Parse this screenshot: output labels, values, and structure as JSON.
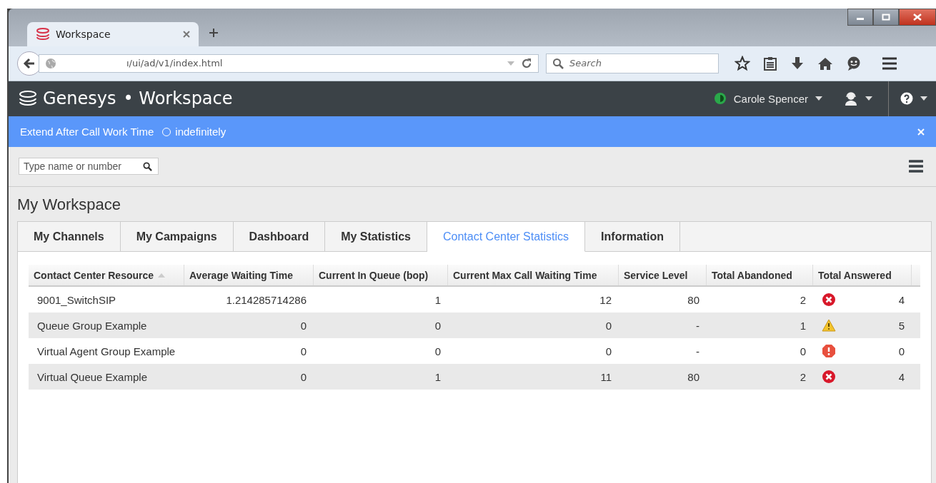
{
  "browser": {
    "tab": {
      "title": "Workspace"
    },
    "url": "ı/ui/ad/v1/index.html",
    "search": {
      "placeholder": "Search"
    }
  },
  "app": {
    "brand": "Genesys",
    "title": "• Workspace",
    "user": {
      "name": "Carole Spencer"
    }
  },
  "banner": {
    "label": "Extend After Call Work Time",
    "option": "indefinitely",
    "selected": false
  },
  "search": {
    "placeholder": "Type name or number"
  },
  "heading": "My Workspace",
  "tabs": [
    {
      "label": "My Channels",
      "selected": false
    },
    {
      "label": "My Campaigns",
      "selected": false
    },
    {
      "label": "Dashboard",
      "selected": false
    },
    {
      "label": "My Statistics",
      "selected": false
    },
    {
      "label": "Contact Center Statistics",
      "selected": true
    },
    {
      "label": "Information",
      "selected": false
    }
  ],
  "table": {
    "columns": [
      {
        "label": "Contact Center Resource",
        "sorted": true
      },
      {
        "label": "Average Waiting Time",
        "sorted": false
      },
      {
        "label": "Current In Queue (bop)",
        "sorted": false
      },
      {
        "label": "Current Max Call Waiting Time",
        "sorted": false
      },
      {
        "label": "Service Level",
        "sorted": false
      },
      {
        "label": "Total Abandoned",
        "sorted": false
      },
      {
        "label": "Total Answered",
        "sorted": false
      }
    ],
    "rows": [
      {
        "cells": [
          "9001_SwitchSIP",
          "1.214285714286",
          "1",
          "12",
          "80",
          "2",
          "4"
        ],
        "kind": "error"
      },
      {
        "cells": [
          "Queue Group Example",
          "0",
          "0",
          "0",
          "-",
          "1",
          "5"
        ],
        "kind": "warning"
      },
      {
        "cells": [
          "Virtual Agent Group Example",
          "0",
          "0",
          "0",
          "-",
          "0",
          "0"
        ],
        "kind": "critical"
      },
      {
        "cells": [
          "Virtual Queue Example",
          "0",
          "1",
          "11",
          "80",
          "2",
          "4"
        ],
        "kind": "error"
      }
    ]
  }
}
